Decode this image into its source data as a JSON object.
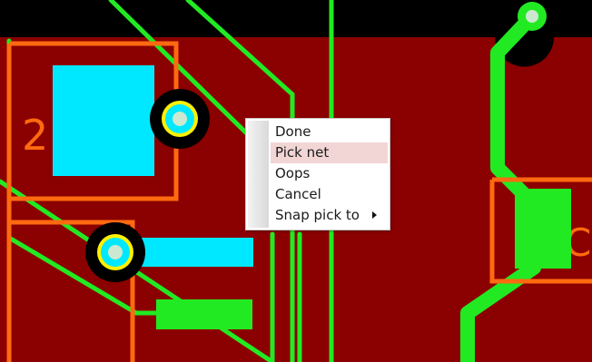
{
  "pcb": {
    "component_text_left": "2",
    "component_text_right": "C",
    "colors": {
      "board": "#8b0000",
      "trace": "#22ea22",
      "silkscreen": "#ff6a10",
      "pad": "#00e8ff",
      "highlight": "#fff200",
      "background": "#000000"
    }
  },
  "context_menu": {
    "items": [
      {
        "label": "Done",
        "highlighted": false
      },
      {
        "label": "Pick net",
        "highlighted": true
      },
      {
        "label": "Oops",
        "highlighted": false
      },
      {
        "label": "Cancel",
        "highlighted": false
      },
      {
        "label": "Snap pick to",
        "highlighted": false,
        "submenu": true
      }
    ]
  }
}
